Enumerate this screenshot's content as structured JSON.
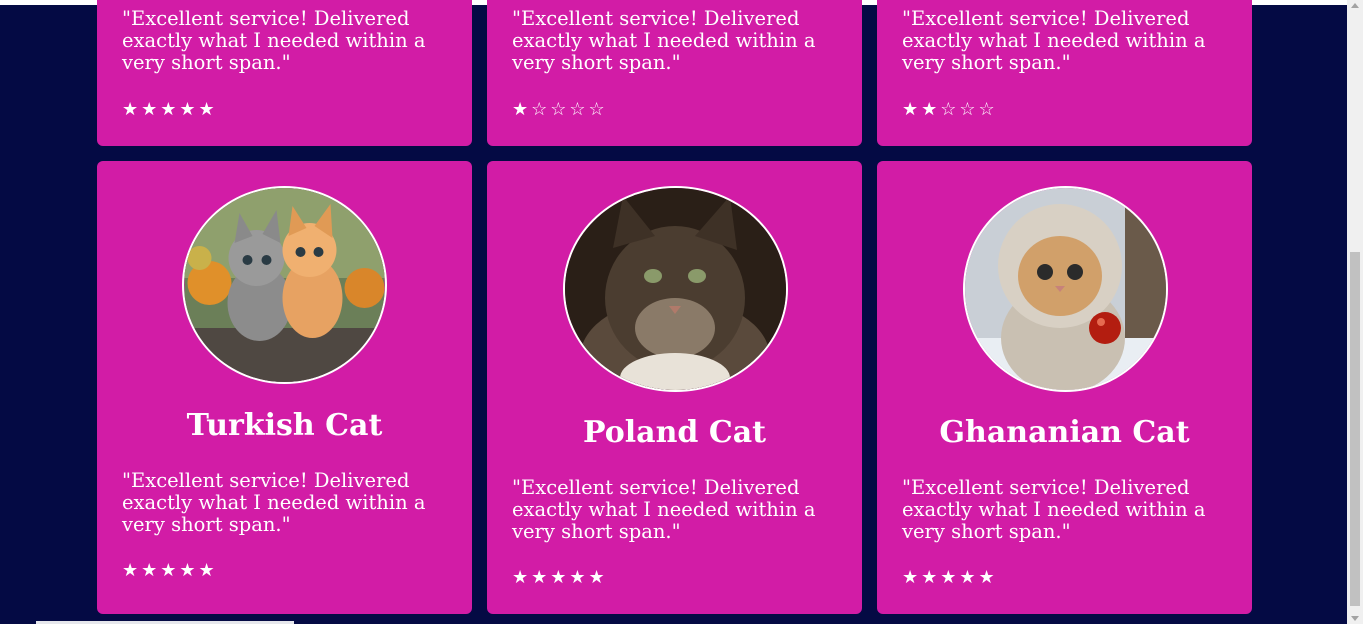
{
  "top_cards": [
    {
      "quote": "\"Excellent service! Delivered exactly what I needed within a very short span.\"",
      "rating": 5,
      "stars": "★★★★★"
    },
    {
      "quote": "\"Excellent service! Delivered exactly what I needed within a very short span.\"",
      "rating": 1,
      "stars": "★☆☆☆☆"
    },
    {
      "quote": "\"Excellent service! Delivered exactly what I needed within a very short span.\"",
      "rating": 2,
      "stars": "★★☆☆☆"
    }
  ],
  "cards": [
    {
      "name": "Turkish Cat",
      "quote": "\"Excellent service! Delivered exactly what I needed within a very short span.\"",
      "rating": 5,
      "stars": "★★★★★",
      "photo": "two-kittens-photo"
    },
    {
      "name": "Poland Cat",
      "quote": "\"Excellent service! Delivered exactly what I needed within a very short span.\"",
      "rating": 5,
      "stars": "★★★★★",
      "photo": "long-haired-cat-photo"
    },
    {
      "name": "Ghananian Cat",
      "quote": "\"Excellent service! Delivered exactly what I needed within a very short span.\"",
      "rating": 5,
      "stars": "★★★★★",
      "photo": "kitten-in-hoodie-photo"
    }
  ],
  "colors": {
    "background": "#040a44",
    "card": "#d21ca6",
    "text": "#ffffff"
  }
}
